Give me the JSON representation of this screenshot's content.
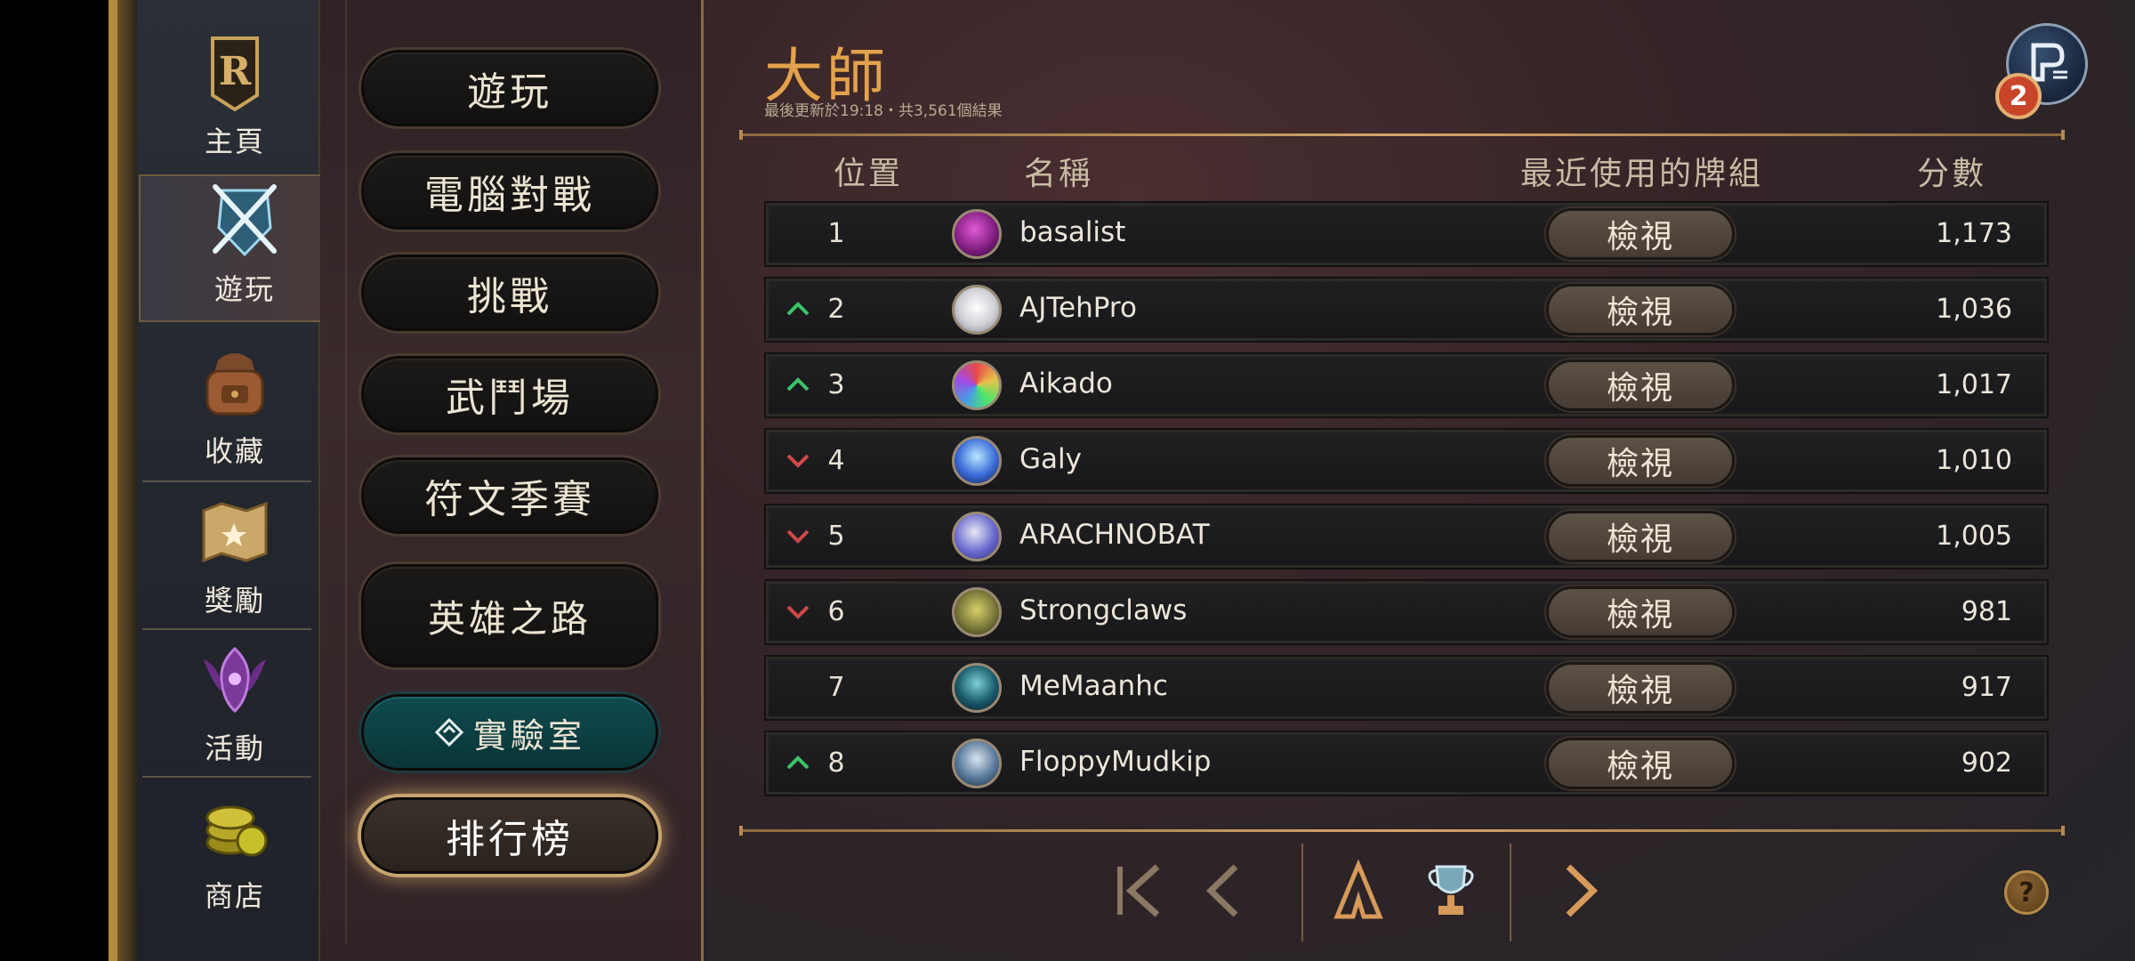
{
  "nav": {
    "items": [
      {
        "label": "主頁",
        "icon": "runeterra-logo-icon"
      },
      {
        "label": "遊玩",
        "icon": "crossed-swords-icon"
      },
      {
        "label": "收藏",
        "icon": "backpack-icon"
      },
      {
        "label": "獎勵",
        "icon": "map-scroll-icon"
      },
      {
        "label": "活動",
        "icon": "event-emblem-icon"
      },
      {
        "label": "商店",
        "icon": "coins-icon"
      }
    ]
  },
  "submenu": {
    "items": [
      {
        "label": "遊玩"
      },
      {
        "label": "電腦對戰"
      },
      {
        "label": "挑戰"
      },
      {
        "label": "武鬥場"
      },
      {
        "label": "符文季賽"
      },
      {
        "label": "英雄之路"
      },
      {
        "label": "實驗室"
      },
      {
        "label": "排行榜"
      }
    ]
  },
  "leaderboard": {
    "title": "大師",
    "subtitle": "最後更新於19:18・共3,561個結果",
    "headers": {
      "position": "位置",
      "name": "名稱",
      "deck": "最近使用的牌組",
      "score": "分數"
    },
    "view_label": "檢視",
    "rows": [
      {
        "pos": "1",
        "trend": "none",
        "name": "basalist",
        "score": "1,173"
      },
      {
        "pos": "2",
        "trend": "up",
        "name": "AJTehPro",
        "score": "1,036"
      },
      {
        "pos": "3",
        "trend": "up",
        "name": "Aikado",
        "score": "1,017"
      },
      {
        "pos": "4",
        "trend": "down",
        "name": "Galy",
        "score": "1,010"
      },
      {
        "pos": "5",
        "trend": "down",
        "name": "ARACHNOBAT",
        "score": "1,005"
      },
      {
        "pos": "6",
        "trend": "down",
        "name": "Strongclaws",
        "score": "981"
      },
      {
        "pos": "7",
        "trend": "none",
        "name": "MeMaanhc",
        "score": "917"
      },
      {
        "pos": "8",
        "trend": "up",
        "name": "FloppyMudkip",
        "score": "902"
      }
    ]
  },
  "profile": {
    "badge_count": "2"
  },
  "help": {
    "label": "?"
  },
  "colors": {
    "accent_gold": "#e3a24b",
    "trend_up": "#3cc46a",
    "trend_down": "#d04848",
    "lab_teal": "#0f4a4e"
  }
}
